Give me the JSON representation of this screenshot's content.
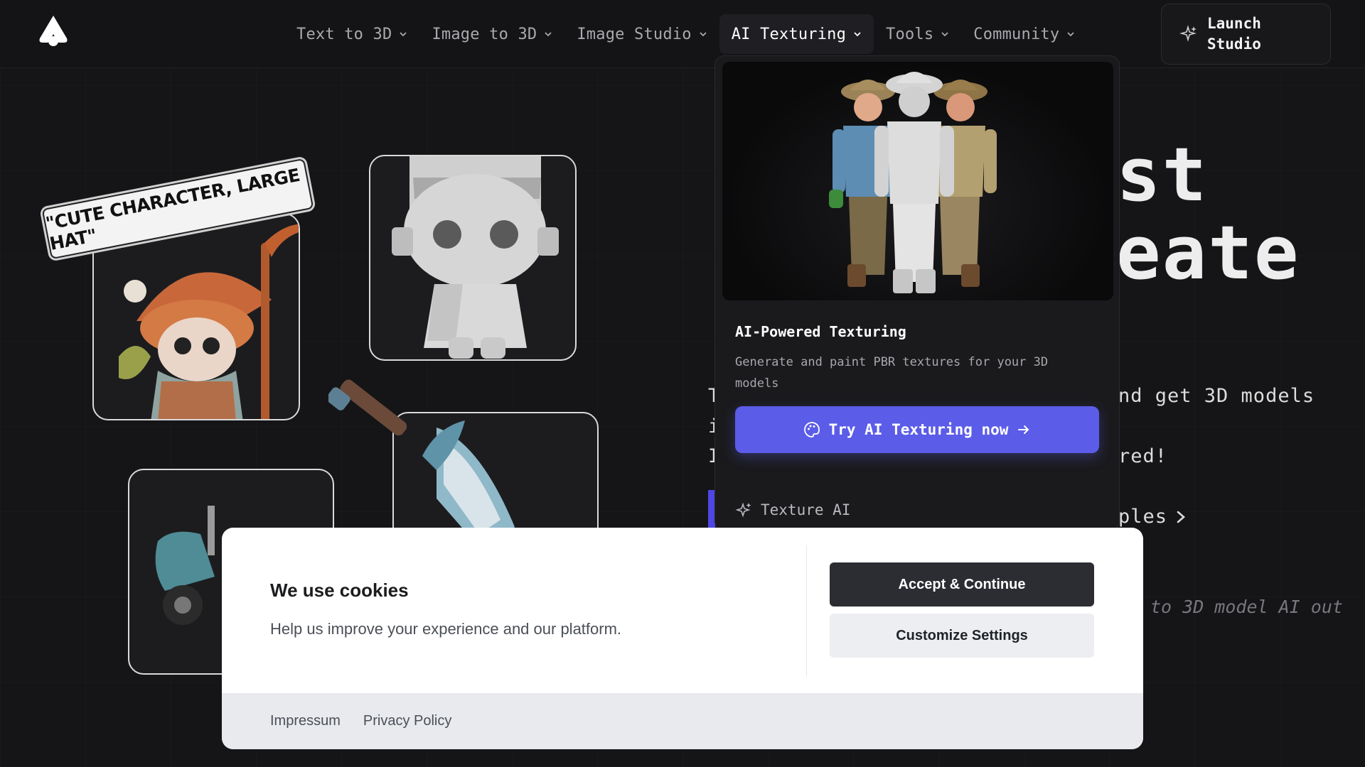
{
  "nav": {
    "items": [
      {
        "label": "Text to 3D"
      },
      {
        "label": "Image to 3D"
      },
      {
        "label": "Image Studio"
      },
      {
        "label": "AI Texturing"
      },
      {
        "label": "Tools"
      },
      {
        "label": "Community"
      }
    ],
    "launch_label": "Launch Studio"
  },
  "hero": {
    "line1": "st",
    "line2": "eate",
    "desc1": "nd get 3D models",
    "desc2": "red!",
    "examples_link": "ples",
    "tagline": "to 3D model AI out",
    "frag_t": "T",
    "frag_i": "i",
    "frag_I": "I"
  },
  "showcase": {
    "tag_text": "\"CUTE CHARACTER, LARGE HAT\""
  },
  "dropdown": {
    "title": "AI-Powered Texturing",
    "description": "Generate and paint PBR textures for your 3D models",
    "cta_label": "Try AI Texturing now",
    "sub_item": "Texture AI"
  },
  "cookie": {
    "title": "We use cookies",
    "text": "Help us improve your experience and our platform.",
    "accept_label": "Accept & Continue",
    "customize_label": "Customize Settings",
    "footer_links": [
      "Impressum",
      "Privacy Policy"
    ]
  },
  "colors": {
    "background": "#151517",
    "accent": "#5b5ce8",
    "accept_button": "#2b2d33",
    "modal": "#ffffff"
  }
}
